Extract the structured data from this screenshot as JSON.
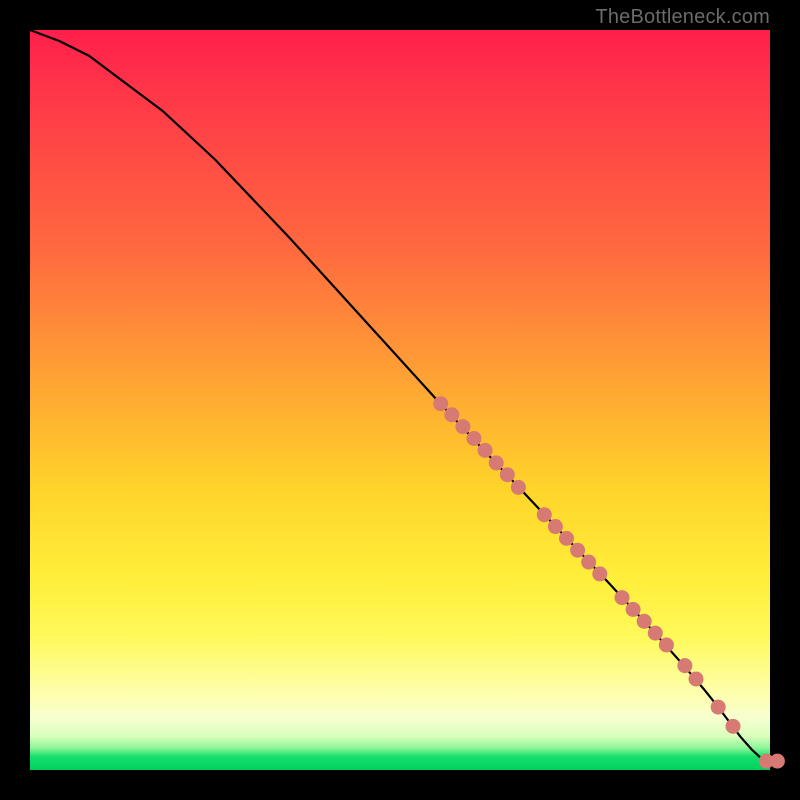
{
  "attribution": "TheBottleneck.com",
  "colors": {
    "gradient_top": "#ff1f4b",
    "gradient_mid1": "#ffa533",
    "gradient_mid2": "#ffee3a",
    "gradient_bottom": "#00d060",
    "curve": "#000000",
    "marker_fill": "#d77a74",
    "marker_stroke": "#b85f59",
    "background": "#000000"
  },
  "chart_data": {
    "type": "line",
    "title": "",
    "xlabel": "",
    "ylabel": "",
    "xlim": [
      0,
      100
    ],
    "ylim": [
      0,
      100
    ],
    "grid": false,
    "series": [
      {
        "name": "curve",
        "x": [
          0,
          4,
          8,
          12,
          18,
          25,
          35,
          45,
          55,
          62,
          70,
          78,
          84,
          88,
          91,
          93,
          94.5,
          96,
          97.5,
          99,
          100
        ],
        "y": [
          100,
          98.5,
          96.5,
          93.5,
          89,
          82.5,
          72,
          61,
          50,
          42.5,
          34,
          25.5,
          19,
          14.5,
          11,
          8.5,
          6.5,
          4.5,
          2.8,
          1.4,
          1.2
        ]
      }
    ],
    "markers": [
      {
        "x": 55.5,
        "y": 49.5
      },
      {
        "x": 57.0,
        "y": 48.0
      },
      {
        "x": 58.5,
        "y": 46.4
      },
      {
        "x": 60.0,
        "y": 44.8
      },
      {
        "x": 61.5,
        "y": 43.2
      },
      {
        "x": 63.0,
        "y": 41.5
      },
      {
        "x": 64.5,
        "y": 39.9
      },
      {
        "x": 66.0,
        "y": 38.2
      },
      {
        "x": 69.5,
        "y": 34.5
      },
      {
        "x": 71.0,
        "y": 32.9
      },
      {
        "x": 72.5,
        "y": 31.3
      },
      {
        "x": 74.0,
        "y": 29.7
      },
      {
        "x": 75.5,
        "y": 28.1
      },
      {
        "x": 77.0,
        "y": 26.5
      },
      {
        "x": 80.0,
        "y": 23.3
      },
      {
        "x": 81.5,
        "y": 21.7
      },
      {
        "x": 83.0,
        "y": 20.1
      },
      {
        "x": 84.5,
        "y": 18.5
      },
      {
        "x": 86.0,
        "y": 16.9
      },
      {
        "x": 88.5,
        "y": 14.1
      },
      {
        "x": 90.0,
        "y": 12.3
      },
      {
        "x": 93.0,
        "y": 8.5
      },
      {
        "x": 95.0,
        "y": 5.9
      },
      {
        "x": 99.5,
        "y": 1.2
      },
      {
        "x": 101.0,
        "y": 1.2
      }
    ]
  }
}
